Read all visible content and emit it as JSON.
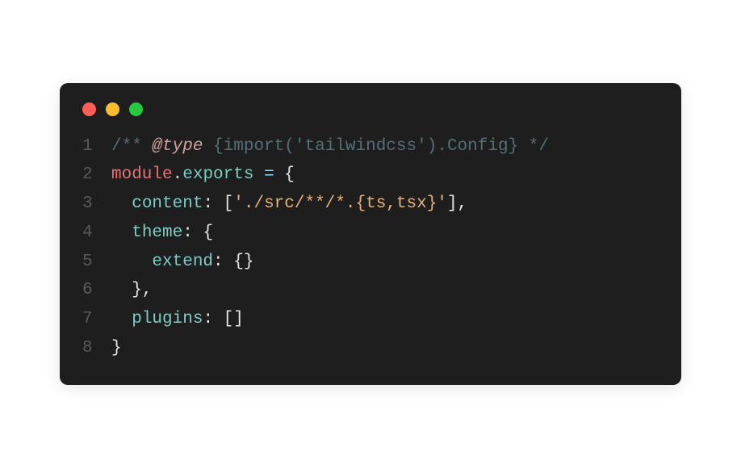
{
  "window": {
    "controls": {
      "close": "close",
      "minimize": "minimize",
      "maximize": "maximize"
    }
  },
  "code": {
    "lineNumbers": [
      "1",
      "2",
      "3",
      "4",
      "5",
      "6",
      "7",
      "8"
    ],
    "line1": {
      "comment_open": "/** ",
      "tag": "@type",
      "space1": " ",
      "brace_open": "{",
      "import_kw": "import",
      "paren_open": "(",
      "string": "'tailwindcss'",
      "paren_close": ")",
      "dot": ".",
      "config": "Config",
      "brace_close": "}",
      "comment_close": " */"
    },
    "line2": {
      "module": "module",
      "dot": ".",
      "exports": "exports",
      "space": " ",
      "equals": "=",
      "space2": " ",
      "brace": "{"
    },
    "line3": {
      "indent": "  ",
      "content": "content",
      "colon": ":",
      "space": " ",
      "bracket_open": "[",
      "string": "'./src/**/*.{ts,tsx}'",
      "bracket_close": "]",
      "comma": ","
    },
    "line4": {
      "indent": "  ",
      "theme": "theme",
      "colon": ":",
      "space": " ",
      "brace": "{"
    },
    "line5": {
      "indent": "    ",
      "extend": "extend",
      "colon": ":",
      "space": " ",
      "braces": "{}"
    },
    "line6": {
      "indent": "  ",
      "brace": "}",
      "comma": ","
    },
    "line7": {
      "indent": "  ",
      "plugins": "plugins",
      "colon": ":",
      "space": " ",
      "brackets": "[]"
    },
    "line8": {
      "brace": "}"
    }
  }
}
